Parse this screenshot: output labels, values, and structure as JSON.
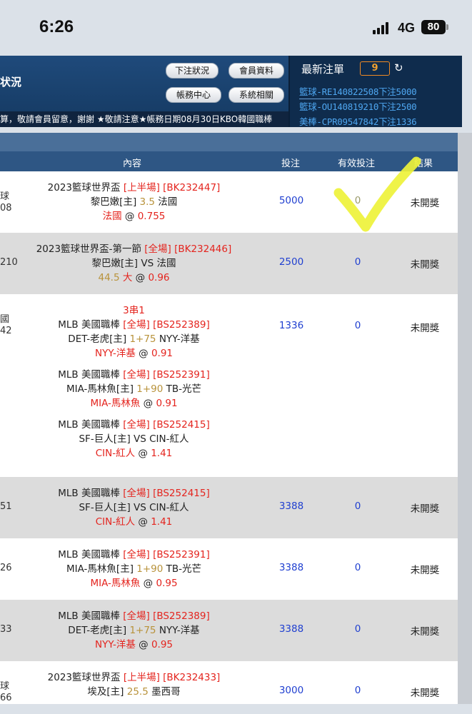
{
  "status": {
    "time": "6:26",
    "network": "4G",
    "battery": "80"
  },
  "header": {
    "title": "状況",
    "buttons": {
      "bet_status": "下注狀況",
      "member_info": "會員資料",
      "account_center": "帳務中心",
      "system": "系統相關"
    }
  },
  "latest": {
    "title": "最新注單",
    "count": "9",
    "items": [
      "籃球-RE140822508下注5000",
      "籃球-OU140819210下注2500",
      "美棒-CPR09547842下注1336"
    ]
  },
  "marquee": "算，敬請會員留意，謝謝 ★敬請注意★帳務日期08月30日KBO韓國職棒",
  "table": {
    "headers": {
      "content": "內容",
      "bet": "投注",
      "valid": "有效投注",
      "result": "結果"
    },
    "rows": [
      {
        "left": [
          "球",
          "08"
        ],
        "lines": [
          [
            {
              "t": "2023籃球世界盃 ",
              "c": "dark"
            },
            {
              "t": "[上半場] [BK232447]",
              "c": "red"
            }
          ],
          [
            {
              "t": "黎巴嫩[主] ",
              "c": "dark"
            },
            {
              "t": "3.5",
              "c": "gold"
            },
            {
              "t": " 法國",
              "c": "dark"
            }
          ],
          [
            {
              "t": "法國",
              "c": "red"
            },
            {
              "t": " @ ",
              "c": "dark"
            },
            {
              "t": "0.755",
              "c": "red"
            }
          ]
        ],
        "bet": "5000",
        "valid": "0",
        "result": "未開獎"
      },
      {
        "left": [
          "210"
        ],
        "lines": [
          [
            {
              "t": "2023籃球世界盃-第一節 ",
              "c": "dark"
            },
            {
              "t": "[全場] [BK232446]",
              "c": "red"
            }
          ],
          [
            {
              "t": "黎巴嫩[主] VS 法國",
              "c": "dark"
            }
          ],
          [
            {
              "t": "44.5 ",
              "c": "gold"
            },
            {
              "t": "大",
              "c": "red"
            },
            {
              "t": " @ ",
              "c": "dark"
            },
            {
              "t": "0.96",
              "c": "red"
            }
          ]
        ],
        "bet": "2500",
        "valid": "0",
        "result": "未開獎"
      },
      {
        "left": [
          "國",
          "42"
        ],
        "lines": [
          [
            {
              "t": "3串1",
              "c": "red"
            }
          ],
          [
            {
              "t": "MLB 美國職棒 ",
              "c": "dark"
            },
            {
              "t": "[全場] [BS252389]",
              "c": "red"
            }
          ],
          [
            {
              "t": "DET-老虎[主] ",
              "c": "dark"
            },
            {
              "t": "1+75",
              "c": "gold"
            },
            {
              "t": " NYY-洋基",
              "c": "dark"
            }
          ],
          [
            {
              "t": "NYY-洋基",
              "c": "red"
            },
            {
              "t": " @ ",
              "c": "dark"
            },
            {
              "t": "0.91",
              "c": "red"
            }
          ],
          [],
          [
            {
              "t": "MLB 美國職棒 ",
              "c": "dark"
            },
            {
              "t": "[全場] [BS252391]",
              "c": "red"
            }
          ],
          [
            {
              "t": "MIA-馬林魚[主] ",
              "c": "dark"
            },
            {
              "t": "1+90",
              "c": "gold"
            },
            {
              "t": " TB-光芒",
              "c": "dark"
            }
          ],
          [
            {
              "t": "MIA-馬林魚",
              "c": "red"
            },
            {
              "t": " @ ",
              "c": "dark"
            },
            {
              "t": "0.91",
              "c": "red"
            }
          ],
          [],
          [
            {
              "t": "MLB 美國職棒 ",
              "c": "dark"
            },
            {
              "t": "[全場] [BS252415]",
              "c": "red"
            }
          ],
          [
            {
              "t": "SF-巨人[主] VS CIN-紅人",
              "c": "dark"
            }
          ],
          [
            {
              "t": "CIN-紅人",
              "c": "red"
            },
            {
              "t": " @ ",
              "c": "dark"
            },
            {
              "t": "1.41",
              "c": "red"
            }
          ]
        ],
        "bet": "1336",
        "valid": "0",
        "result": "未開獎"
      },
      {
        "left": [
          "51"
        ],
        "lines": [
          [
            {
              "t": "MLB 美國職棒 ",
              "c": "dark"
            },
            {
              "t": "[全場] [BS252415]",
              "c": "red"
            }
          ],
          [
            {
              "t": "SF-巨人[主] VS CIN-紅人",
              "c": "dark"
            }
          ],
          [
            {
              "t": "CIN-紅人",
              "c": "red"
            },
            {
              "t": " @ ",
              "c": "dark"
            },
            {
              "t": "1.41",
              "c": "red"
            }
          ]
        ],
        "bet": "3388",
        "valid": "0",
        "result": "未開獎"
      },
      {
        "left": [
          "26"
        ],
        "lines": [
          [
            {
              "t": "MLB 美國職棒 ",
              "c": "dark"
            },
            {
              "t": "[全場] [BS252391]",
              "c": "red"
            }
          ],
          [
            {
              "t": "MIA-馬林魚[主] ",
              "c": "dark"
            },
            {
              "t": "1+90",
              "c": "gold"
            },
            {
              "t": " TB-光芒",
              "c": "dark"
            }
          ],
          [
            {
              "t": "MIA-馬林魚",
              "c": "red"
            },
            {
              "t": " @ ",
              "c": "dark"
            },
            {
              "t": "0.95",
              "c": "red"
            }
          ]
        ],
        "bet": "3388",
        "valid": "0",
        "result": "未開獎"
      },
      {
        "left": [
          "33"
        ],
        "lines": [
          [
            {
              "t": "MLB 美國職棒 ",
              "c": "dark"
            },
            {
              "t": "[全場] [BS252389]",
              "c": "red"
            }
          ],
          [
            {
              "t": "DET-老虎[主] ",
              "c": "dark"
            },
            {
              "t": "1+75",
              "c": "gold"
            },
            {
              "t": " NYY-洋基",
              "c": "dark"
            }
          ],
          [
            {
              "t": "NYY-洋基",
              "c": "red"
            },
            {
              "t": " @ ",
              "c": "dark"
            },
            {
              "t": "0.95",
              "c": "red"
            }
          ]
        ],
        "bet": "3388",
        "valid": "0",
        "result": "未開獎"
      },
      {
        "left": [
          "球",
          "66"
        ],
        "lines": [
          [
            {
              "t": "2023籃球世界盃 ",
              "c": "dark"
            },
            {
              "t": "[上半場] [BK232433]",
              "c": "red"
            }
          ],
          [
            {
              "t": "埃及[主] ",
              "c": "dark"
            },
            {
              "t": "25.5",
              "c": "gold"
            },
            {
              "t": " 墨西哥",
              "c": "dark"
            }
          ],
          [
            {
              "t": "",
              "c": "red"
            }
          ]
        ],
        "bet": "3000",
        "valid": "0",
        "result": "未開獎"
      }
    ]
  },
  "colors": {
    "header_bg": "#1f4a7b",
    "table_head": "#2e5684",
    "red": "#e4241e",
    "gold": "#b8923a",
    "blue_num": "#1f3fd0",
    "check_mark": "#eef23a"
  }
}
